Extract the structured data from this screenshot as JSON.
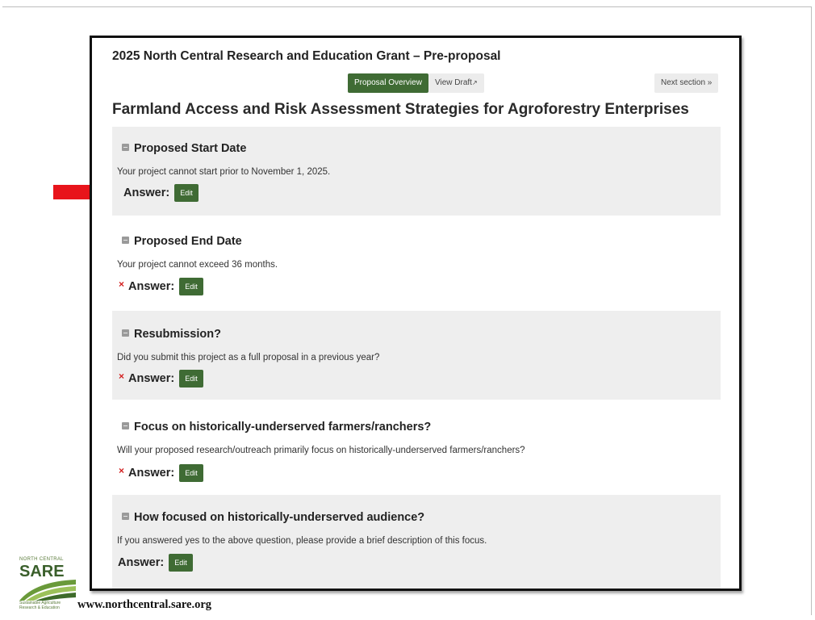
{
  "grant_title": "2025 North Central Research and Education Grant – Pre-proposal",
  "nav": {
    "overview_label": "Proposal Overview",
    "draft_label": "View Draft",
    "next_label": "Next section »"
  },
  "project_title": "Farmland Access and Risk Assessment Strategies for Agroforestry Enterprises",
  "questions": [
    {
      "title": "Proposed Start Date",
      "description": "Your project cannot start prior to November 1, 2025.",
      "answer_label": "Answer:",
      "edit_label": "Edit",
      "missing": false
    },
    {
      "title": "Proposed End Date",
      "description": "Your project cannot exceed 36 months.",
      "answer_label": "Answer:",
      "edit_label": "Edit",
      "missing": true
    },
    {
      "title": "Resubmission?",
      "description": "Did you submit this project as a full proposal in a previous year?",
      "answer_label": "Answer:",
      "edit_label": "Edit",
      "missing": true
    },
    {
      "title": "Focus on historically-underserved farmers/ranchers?",
      "description": "Will your proposed research/outreach primarily focus on historically-underserved farmers/ranchers?",
      "answer_label": "Answer:",
      "edit_label": "Edit",
      "missing": true
    },
    {
      "title": "How focused on historically-underserved audience?",
      "description": "If you answered yes to the above question, please provide a brief description of this focus.",
      "answer_label": "Answer:",
      "edit_label": "Edit",
      "missing": false
    }
  ],
  "logo": {
    "top_text": "NORTH CENTRAL",
    "main_text": "SARE",
    "sub_text": "Sustainable Agriculture Research & Education"
  },
  "footer_url": "www.northcentral.sare.org",
  "colors": {
    "accent_green": "#3f6b34",
    "arrow_red": "#e8141b",
    "missing_red": "#d32020"
  }
}
